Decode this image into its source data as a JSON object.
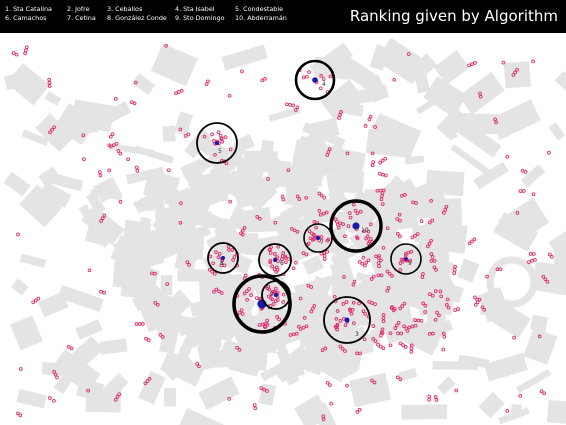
{
  "header": {
    "title": "Ranking given by Algorithm",
    "background": "#000000",
    "text_color": "#ffffff"
  },
  "legend": {
    "items": [
      {
        "rank": 1,
        "label": "1. Sta Catalina"
      },
      {
        "rank": 2,
        "label": "2. Jofre"
      },
      {
        "rank": 3,
        "label": "3. Ceballos"
      },
      {
        "rank": 4,
        "label": "4. Sta Isabel"
      },
      {
        "rank": 5,
        "label": "5. Condestable"
      },
      {
        "rank": 6,
        "label": "6. Camachos"
      },
      {
        "rank": 7,
        "label": "7. Cetina"
      },
      {
        "rank": 8,
        "label": "8. González Conde"
      },
      {
        "rank": 9,
        "label": "9. Sto Domingo"
      },
      {
        "rank": 10,
        "label": "10. Abderramán"
      }
    ]
  },
  "map": {
    "colors": {
      "background": "#ffffff",
      "buildings": "#e4e4e4",
      "points": "#e0306e",
      "centers": "#1a1aa8",
      "rings": "#000000",
      "labels": "#333333"
    },
    "ranked_locations": [
      {
        "rank": 1,
        "marker": "1"
      },
      {
        "rank": 2,
        "marker": "2"
      },
      {
        "rank": 3,
        "marker": "3"
      },
      {
        "rank": 4,
        "marker": "4"
      },
      {
        "rank": 5,
        "marker": "5"
      },
      {
        "rank": 6,
        "marker": "6"
      },
      {
        "rank": 7,
        "marker": "7"
      },
      {
        "rank": 8,
        "marker": "8"
      },
      {
        "rank": 9,
        "marker": "9"
      },
      {
        "rank": 10,
        "marker": "10"
      }
    ]
  }
}
